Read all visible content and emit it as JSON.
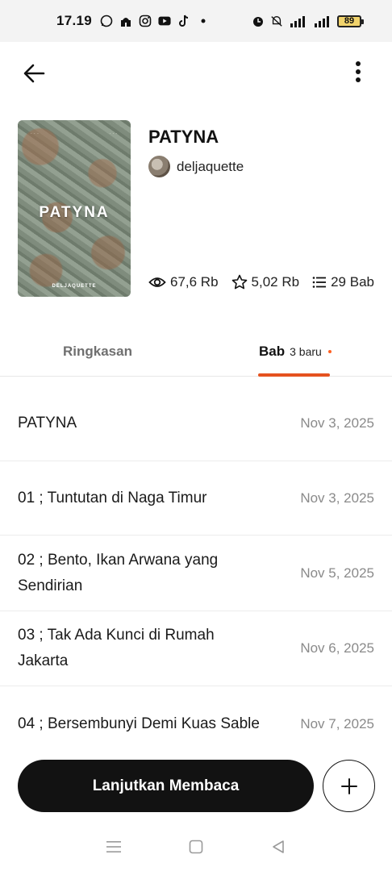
{
  "status_bar": {
    "time": "17.19",
    "network": "4G",
    "battery": "89",
    "left_icons": [
      "whatsapp-icon",
      "mosque-icon",
      "instagram-icon",
      "youtube-icon",
      "tiktok-icon",
      "dot-icon"
    ],
    "right_icons": [
      "alarm-icon",
      "mute-icon",
      "signal-icon",
      "signal-icon",
      "battery-icon"
    ]
  },
  "app_bar": {
    "back_icon": "arrow-left-icon",
    "more_icon": "more-vertical-icon"
  },
  "story": {
    "title": "PATYNA",
    "author": "deljaquette",
    "cover": {
      "title": "PATYNA",
      "author": "DELJAQUETTE"
    },
    "stats": {
      "reads": "67,6 Rb",
      "votes": "5,02 Rb",
      "parts": "29 Bab"
    }
  },
  "tabs": {
    "summary_label": "Ringkasan",
    "chapters_label": "Bab",
    "chapters_new": "3 baru",
    "active": "Bab",
    "accent_color": "#e5521f"
  },
  "chapters": [
    {
      "title": "PATYNA",
      "date": "Nov 3, 2025"
    },
    {
      "title": "01 ; Tuntutan di Naga Timur",
      "date": "Nov 3, 2025"
    },
    {
      "title": "02 ; Bento, Ikan Arwana yang Sendirian",
      "date": "Nov 5, 2025"
    },
    {
      "title": "03 ; Tak Ada Kunci di Rumah Jakarta",
      "date": "Nov 6, 2025"
    },
    {
      "title": "04 ; Bersembunyi Demi Kuas Sable",
      "date": "Nov 7, 2025"
    }
  ],
  "actions": {
    "continue_label": "Lanjutkan Membaca",
    "add_icon": "plus-icon"
  },
  "nav_bar": {
    "icons": [
      "menu-icon",
      "home-square-icon",
      "back-triangle-icon"
    ]
  }
}
